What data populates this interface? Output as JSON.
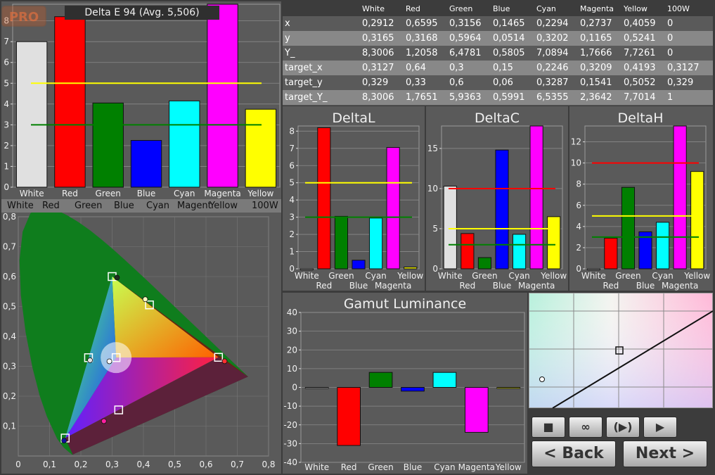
{
  "badge": {
    "pro": "PRO"
  },
  "colors": {
    "White": "#e0e0e0",
    "Red": "#ff0000",
    "Green": "#008000",
    "Blue": "#0000ff",
    "Cyan": "#00ffff",
    "Magenta": "#ff00ff",
    "Yellow": "#ffff00",
    "yellow_line": "#ffff00",
    "green_line": "#008000",
    "red_line": "#ff0000"
  },
  "delta_e": {
    "title": "Delta E 94 (Avg. 5,506)",
    "y_ticks": [
      "0",
      "1",
      "2",
      "3",
      "4",
      "5",
      "6",
      "7",
      "8"
    ],
    "categories": [
      "White",
      "Red",
      "Green",
      "Blue",
      "Cyan",
      "Magenta",
      "Yellow"
    ],
    "strip_labels": [
      "White",
      "Red",
      "Green",
      "Blue",
      "Cyan",
      "Magent",
      "Yellow",
      "100W"
    ]
  },
  "table": {
    "columns": [
      "",
      "White",
      "Red",
      "Green",
      "Blue",
      "Cyan",
      "Magenta",
      "Yellow",
      "100W"
    ],
    "rows": [
      [
        "x",
        "0,2912",
        "0,6595",
        "0,3156",
        "0,1465",
        "0,2294",
        "0,2737",
        "0,4059",
        "0"
      ],
      [
        "y",
        "0,3165",
        "0,3168",
        "0,5964",
        "0,0514",
        "0,3202",
        "0,1165",
        "0,5241",
        "0"
      ],
      [
        "Y_",
        "8,3006",
        "1,2058",
        "6,4781",
        "0,5805",
        "7,0894",
        "1,7666",
        "7,7261",
        "0"
      ],
      [
        "target_x",
        "0,3127",
        "0,64",
        "0,3",
        "0,15",
        "0,2246",
        "0,3209",
        "0,4193",
        "0,3127"
      ],
      [
        "target_y",
        "0,329",
        "0,33",
        "0,6",
        "0,06",
        "0,3287",
        "0,1541",
        "0,5052",
        "0,329"
      ],
      [
        "target_Y_",
        "8,3006",
        "1,7651",
        "5,9363",
        "0,5991",
        "6,5355",
        "2,3642",
        "7,7014",
        "1"
      ]
    ]
  },
  "delta_l": {
    "title": "DeltaL",
    "y_ticks": [
      "0",
      "1",
      "2",
      "3",
      "4",
      "5",
      "6",
      "7",
      "8"
    ],
    "top_labels": [
      "White",
      "Green",
      "Cyan",
      "Yellow"
    ],
    "bottom_labels": [
      "Red",
      "Blue",
      "Magenta"
    ]
  },
  "delta_c": {
    "title": "DeltaC",
    "y_ticks": [
      "0",
      "5",
      "10",
      "15"
    ],
    "top_labels": [
      "White",
      "Green",
      "Cyan",
      "Yellow"
    ],
    "bottom_labels": [
      "Red",
      "Blue",
      "Magenta"
    ]
  },
  "delta_h": {
    "title": "DeltaH",
    "y_ticks": [
      "0",
      "2",
      "4",
      "6",
      "8",
      "10",
      "12"
    ],
    "top_labels": [
      "White",
      "Green",
      "Cyan",
      "Yellow"
    ],
    "bottom_labels": [
      "Red",
      "Blue",
      "Magenta"
    ]
  },
  "gamut": {
    "title": "Gamut Luminance",
    "y_ticks": [
      "-40",
      "-30",
      "-20",
      "-10",
      "0",
      "10",
      "20",
      "30",
      "40"
    ],
    "categories": [
      "White",
      "Red",
      "Green",
      "Blue",
      "Cyan",
      "Magenta",
      "Yellow"
    ]
  },
  "cie": {
    "x_ticks": [
      "0",
      "0,1",
      "0,2",
      "0,3",
      "0,4",
      "0,5",
      "0,6",
      "0,7",
      "0,8"
    ],
    "y_ticks": [
      "0,1",
      "0,2",
      "0,3",
      "0,4",
      "0,5",
      "0,6",
      "0,7",
      "0,8"
    ]
  },
  "controls": {
    "stop": "■",
    "loop": "∞",
    "step": "(▶)",
    "play": "▶",
    "back": "< Back",
    "next": "Next >"
  },
  "chart_data": [
    {
      "type": "bar",
      "title": "Delta E 94 (Avg. 5,506)",
      "categories": [
        "White",
        "Red",
        "Green",
        "Blue",
        "Cyan",
        "Magenta",
        "Yellow"
      ],
      "values": [
        7.0,
        8.2,
        4.05,
        2.25,
        4.15,
        8.8,
        3.75
      ],
      "ylim": [
        0,
        8.8
      ],
      "reference_lines": [
        5,
        3
      ]
    },
    {
      "type": "bar",
      "title": "DeltaL",
      "categories": [
        "White",
        "Red",
        "Green",
        "Blue",
        "Cyan",
        "Magenta",
        "Yellow"
      ],
      "values": [
        0,
        8.2,
        3.05,
        0.5,
        2.95,
        7.05,
        0.1
      ],
      "ylim": [
        0,
        8.3
      ],
      "reference_lines": [
        5,
        3
      ]
    },
    {
      "type": "bar",
      "title": "DeltaC",
      "categories": [
        "White",
        "Red",
        "Green",
        "Blue",
        "Cyan",
        "Magenta",
        "Yellow"
      ],
      "values": [
        10.3,
        4.4,
        1.4,
        14.8,
        4.3,
        17.8,
        6.5
      ],
      "ylim": [
        0,
        17.8
      ],
      "reference_lines": [
        10,
        5,
        3
      ]
    },
    {
      "type": "bar",
      "title": "DeltaH",
      "categories": [
        "White",
        "Red",
        "Green",
        "Blue",
        "Cyan",
        "Magenta",
        "Yellow"
      ],
      "values": [
        0,
        2.9,
        7.7,
        3.5,
        4.4,
        13.5,
        9.2
      ],
      "ylim": [
        0,
        13.5
      ],
      "reference_lines": [
        10,
        5,
        3
      ]
    },
    {
      "type": "bar",
      "title": "Gamut Luminance",
      "categories": [
        "White",
        "Red",
        "Green",
        "Blue",
        "Cyan",
        "Magenta",
        "Yellow"
      ],
      "values": [
        0,
        -31,
        8,
        -2,
        8,
        -24,
        0
      ],
      "ylim": [
        -40,
        40
      ]
    },
    {
      "type": "scatter",
      "title": "",
      "xlim": [
        0,
        0.8
      ],
      "ylim": [
        0,
        0.8
      ],
      "series": [
        {
          "values": [
            [
              0.3127,
              0.329
            ],
            [
              0.64,
              0.33
            ],
            [
              0.3,
              0.6
            ],
            [
              0.15,
              0.06
            ],
            [
              0.2246,
              0.3287
            ],
            [
              0.3209,
              0.1541
            ],
            [
              0.4193,
              0.5052
            ]
          ]
        },
        {
          "values": [
            [
              0.2912,
              0.3165
            ],
            [
              0.6595,
              0.3168
            ],
            [
              0.3156,
              0.5964
            ],
            [
              0.1465,
              0.0514
            ],
            [
              0.2294,
              0.3202
            ],
            [
              0.2737,
              0.1165
            ],
            [
              0.4059,
              0.5241
            ]
          ]
        }
      ]
    }
  ]
}
